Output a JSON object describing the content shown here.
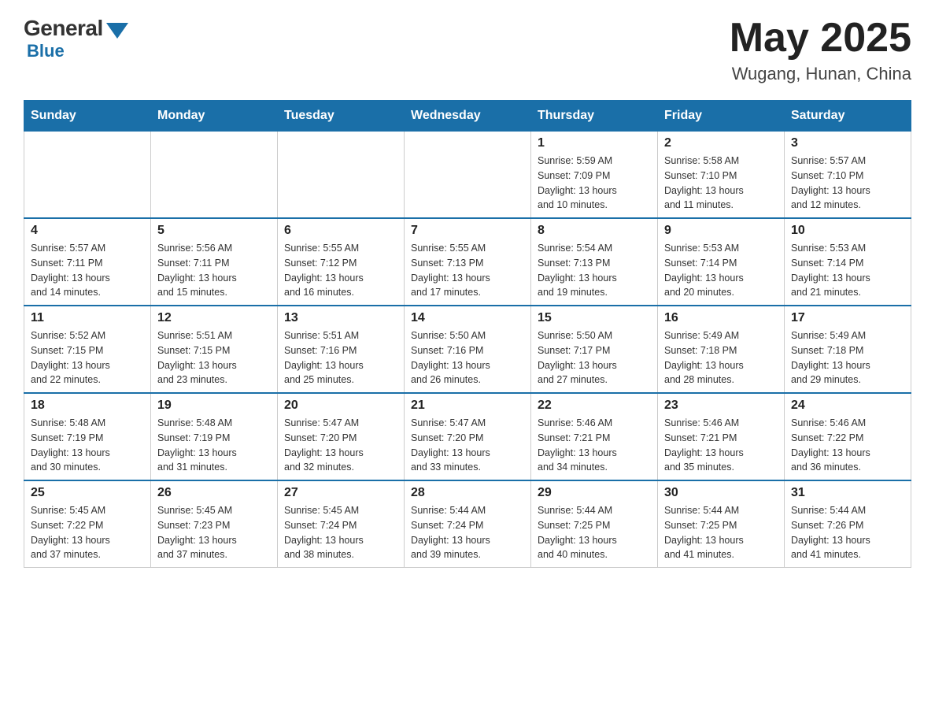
{
  "header": {
    "logo_general": "General",
    "logo_blue": "Blue",
    "month_year": "May 2025",
    "location": "Wugang, Hunan, China"
  },
  "days_of_week": [
    "Sunday",
    "Monday",
    "Tuesday",
    "Wednesday",
    "Thursday",
    "Friday",
    "Saturday"
  ],
  "weeks": [
    [
      {
        "day": "",
        "info": ""
      },
      {
        "day": "",
        "info": ""
      },
      {
        "day": "",
        "info": ""
      },
      {
        "day": "",
        "info": ""
      },
      {
        "day": "1",
        "info": "Sunrise: 5:59 AM\nSunset: 7:09 PM\nDaylight: 13 hours\nand 10 minutes."
      },
      {
        "day": "2",
        "info": "Sunrise: 5:58 AM\nSunset: 7:10 PM\nDaylight: 13 hours\nand 11 minutes."
      },
      {
        "day": "3",
        "info": "Sunrise: 5:57 AM\nSunset: 7:10 PM\nDaylight: 13 hours\nand 12 minutes."
      }
    ],
    [
      {
        "day": "4",
        "info": "Sunrise: 5:57 AM\nSunset: 7:11 PM\nDaylight: 13 hours\nand 14 minutes."
      },
      {
        "day": "5",
        "info": "Sunrise: 5:56 AM\nSunset: 7:11 PM\nDaylight: 13 hours\nand 15 minutes."
      },
      {
        "day": "6",
        "info": "Sunrise: 5:55 AM\nSunset: 7:12 PM\nDaylight: 13 hours\nand 16 minutes."
      },
      {
        "day": "7",
        "info": "Sunrise: 5:55 AM\nSunset: 7:13 PM\nDaylight: 13 hours\nand 17 minutes."
      },
      {
        "day": "8",
        "info": "Sunrise: 5:54 AM\nSunset: 7:13 PM\nDaylight: 13 hours\nand 19 minutes."
      },
      {
        "day": "9",
        "info": "Sunrise: 5:53 AM\nSunset: 7:14 PM\nDaylight: 13 hours\nand 20 minutes."
      },
      {
        "day": "10",
        "info": "Sunrise: 5:53 AM\nSunset: 7:14 PM\nDaylight: 13 hours\nand 21 minutes."
      }
    ],
    [
      {
        "day": "11",
        "info": "Sunrise: 5:52 AM\nSunset: 7:15 PM\nDaylight: 13 hours\nand 22 minutes."
      },
      {
        "day": "12",
        "info": "Sunrise: 5:51 AM\nSunset: 7:15 PM\nDaylight: 13 hours\nand 23 minutes."
      },
      {
        "day": "13",
        "info": "Sunrise: 5:51 AM\nSunset: 7:16 PM\nDaylight: 13 hours\nand 25 minutes."
      },
      {
        "day": "14",
        "info": "Sunrise: 5:50 AM\nSunset: 7:16 PM\nDaylight: 13 hours\nand 26 minutes."
      },
      {
        "day": "15",
        "info": "Sunrise: 5:50 AM\nSunset: 7:17 PM\nDaylight: 13 hours\nand 27 minutes."
      },
      {
        "day": "16",
        "info": "Sunrise: 5:49 AM\nSunset: 7:18 PM\nDaylight: 13 hours\nand 28 minutes."
      },
      {
        "day": "17",
        "info": "Sunrise: 5:49 AM\nSunset: 7:18 PM\nDaylight: 13 hours\nand 29 minutes."
      }
    ],
    [
      {
        "day": "18",
        "info": "Sunrise: 5:48 AM\nSunset: 7:19 PM\nDaylight: 13 hours\nand 30 minutes."
      },
      {
        "day": "19",
        "info": "Sunrise: 5:48 AM\nSunset: 7:19 PM\nDaylight: 13 hours\nand 31 minutes."
      },
      {
        "day": "20",
        "info": "Sunrise: 5:47 AM\nSunset: 7:20 PM\nDaylight: 13 hours\nand 32 minutes."
      },
      {
        "day": "21",
        "info": "Sunrise: 5:47 AM\nSunset: 7:20 PM\nDaylight: 13 hours\nand 33 minutes."
      },
      {
        "day": "22",
        "info": "Sunrise: 5:46 AM\nSunset: 7:21 PM\nDaylight: 13 hours\nand 34 minutes."
      },
      {
        "day": "23",
        "info": "Sunrise: 5:46 AM\nSunset: 7:21 PM\nDaylight: 13 hours\nand 35 minutes."
      },
      {
        "day": "24",
        "info": "Sunrise: 5:46 AM\nSunset: 7:22 PM\nDaylight: 13 hours\nand 36 minutes."
      }
    ],
    [
      {
        "day": "25",
        "info": "Sunrise: 5:45 AM\nSunset: 7:22 PM\nDaylight: 13 hours\nand 37 minutes."
      },
      {
        "day": "26",
        "info": "Sunrise: 5:45 AM\nSunset: 7:23 PM\nDaylight: 13 hours\nand 37 minutes."
      },
      {
        "day": "27",
        "info": "Sunrise: 5:45 AM\nSunset: 7:24 PM\nDaylight: 13 hours\nand 38 minutes."
      },
      {
        "day": "28",
        "info": "Sunrise: 5:44 AM\nSunset: 7:24 PM\nDaylight: 13 hours\nand 39 minutes."
      },
      {
        "day": "29",
        "info": "Sunrise: 5:44 AM\nSunset: 7:25 PM\nDaylight: 13 hours\nand 40 minutes."
      },
      {
        "day": "30",
        "info": "Sunrise: 5:44 AM\nSunset: 7:25 PM\nDaylight: 13 hours\nand 41 minutes."
      },
      {
        "day": "31",
        "info": "Sunrise: 5:44 AM\nSunset: 7:26 PM\nDaylight: 13 hours\nand 41 minutes."
      }
    ]
  ]
}
